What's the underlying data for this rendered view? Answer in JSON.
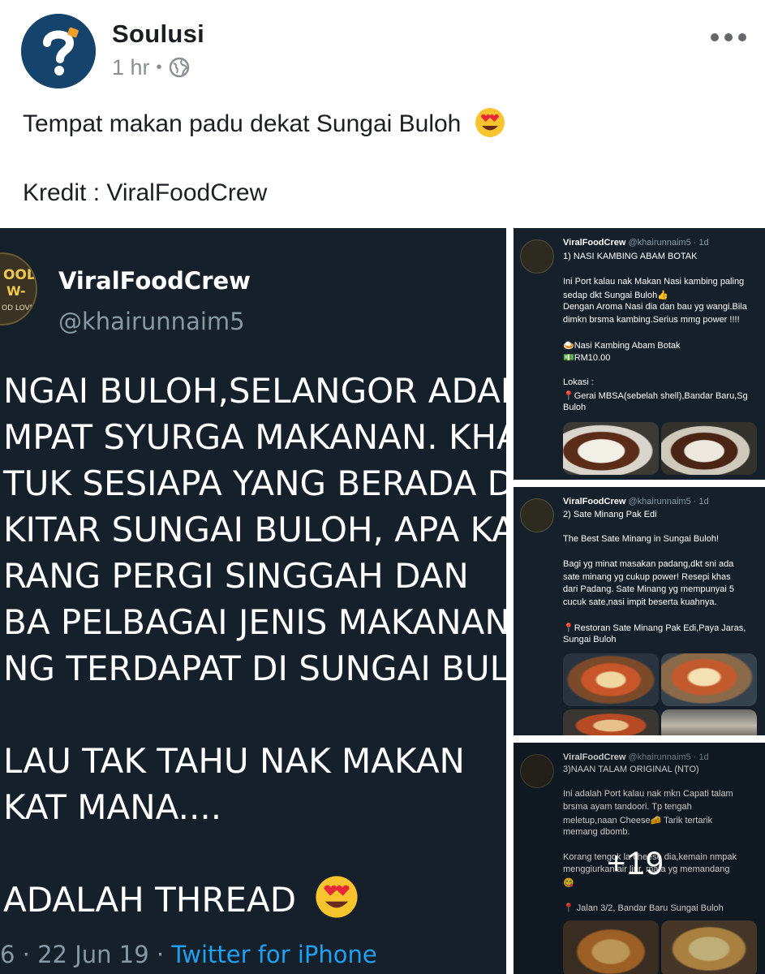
{
  "post": {
    "page_name": "Soulusi",
    "time": "1 hr",
    "privacy_icon": "globe-icon",
    "text_line1": "Tempat makan padu dekat Sungai Buloh",
    "text_line2": "Kredit : ViralFoodCrew"
  },
  "main_image": {
    "account_name": "ViralFoodCrew",
    "handle": "@khairunnaim5",
    "logo_text": [
      "OOD",
      "W-",
      "OD LOVERS!"
    ],
    "lines": [
      "NGAI BULOH,SELANGOR ADALA",
      "MPAT SYURGA MAKANAN. KHA",
      "TUK SESIAPA YANG BERADA D",
      "KITAR SUNGAI BULOH, APA KAT",
      "RANG PERGI SINGGAH DAN",
      "BA PELBAGAI JENIS MAKANAN",
      "NG TERDAPAT DI SUNGAI BULO",
      "LAU TAK TAHU NAK MAKAN",
      "KAT MANA....",
      "ADALAH THREAD"
    ],
    "footer_prefix": "6 · 22 Jun 19 · ",
    "footer_source": "Twitter for iPhone"
  },
  "thumbnails": [
    {
      "name": "ViralFoodCrew",
      "meta": "@khairunnaim5 · 1d",
      "lines": [
        "1) NASI KAMBING ABAM BOTAK",
        "",
        "Ini Port kalau nak Makan Nasi kambing paling",
        "sedap dkt Sungai Buloh👍",
        "Dengan Aroma Nasi dia dan bau yg wangi.Bila",
        "dimkn brsma kambing.Serius mmg power !!!!",
        "",
        "🍛Nasi Kambing Abam Botak",
        "💵RM10.00",
        "",
        "Lokasi :",
        "📍Gerai MBSA(sebelah shell),Bandar Baru,Sg",
        "Buloh"
      ]
    },
    {
      "name": "ViralFoodCrew",
      "meta": "@khairunnaim5 · 1d",
      "lines": [
        "2) Sate Minang Pak Edi",
        "",
        "The Best Sate Minang in Sungai Buloh!",
        "",
        "Bagi yg minat masakan padang,dkt sni ada",
        "sate minang yg cukup power! Resepi khas",
        "dari Padang. Sate Minang yg mempunyai 5",
        "cucuk sate,nasi impit beserta kuahnya.",
        "",
        "📍Restoran Sate Minang Pak Edi,Paya Jaras,",
        "Sungai Buloh"
      ]
    },
    {
      "name": "ViralFoodCrew",
      "meta": "@khairunnaim5 · 1d",
      "lines": [
        "3)NAAN TALAM ORIGINAL (NTO)",
        "",
        "Ini adalah Port kalau nak mkn Capati talam",
        "brsma ayam tandoori. Tp tengah",
        "meletup,naan Cheese🧀 Tarik tertarik",
        "memang dbomb.",
        "",
        "Korang tengok la cheese dia,kemain nmpak",
        "menggiurkan air liur, mata yg memandang",
        "😋",
        "",
        "📍 Jalan 3/2, Bandar Baru Sungai Buloh"
      ],
      "more_count": "+19"
    }
  ],
  "colors": {
    "tweet_bg": "#15202b",
    "link_blue": "#1da1f2",
    "avatar_blue": "#14446c"
  }
}
